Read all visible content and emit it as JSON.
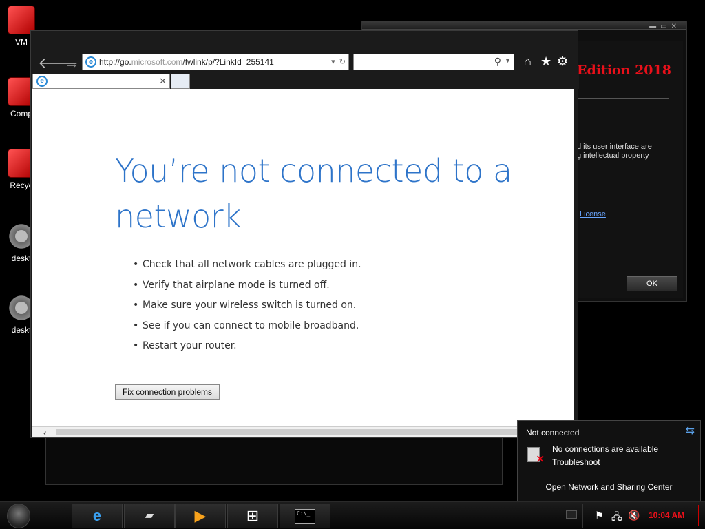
{
  "desktop": {
    "icons": [
      {
        "label": "VM",
        "icon": "vm-icon"
      },
      {
        "label": "Comp",
        "icon": "computer-icon"
      },
      {
        "label": "Recyc",
        "icon": "recycle-bin-icon"
      },
      {
        "label": "deskt",
        "icon": "gear-file-icon"
      },
      {
        "label": "deskt",
        "icon": "gear-file-icon"
      }
    ]
  },
  "about_dialog": {
    "edition_text": "Edition 2018",
    "line1": "d its user interface are",
    "line2": "g intellectual property",
    "license_link": "License",
    "ok_label": "OK"
  },
  "browser": {
    "address": {
      "prefix": "http://go.",
      "domain": "microsoft.com",
      "path": "/fwlink/p/?LinkId=255141"
    },
    "search_placeholder": "",
    "tab_title": "",
    "page": {
      "heading": "You’re not connected to a network",
      "tips": [
        "Check that all network cables are plugged in.",
        "Verify that airplane mode is turned off.",
        "Make sure your wireless switch is turned on.",
        "See if you can connect to mobile broadband.",
        "Restart your router."
      ],
      "fix_button": "Fix connection problems"
    }
  },
  "network_flyout": {
    "status": "Not connected",
    "message": "No connections are available",
    "troubleshoot": "Troubleshoot",
    "link": "Open Network and Sharing Center"
  },
  "taskbar": {
    "buttons": [
      "internet-explorer",
      "vmware",
      "media-player",
      "windows-explorer",
      "command-prompt"
    ],
    "cmd_text": "C:\\_",
    "clock": "10:04 AM"
  },
  "colors": {
    "heading_blue": "#2e74c9",
    "edition_red": "#e8101a",
    "clock_red": "#e8101a"
  }
}
